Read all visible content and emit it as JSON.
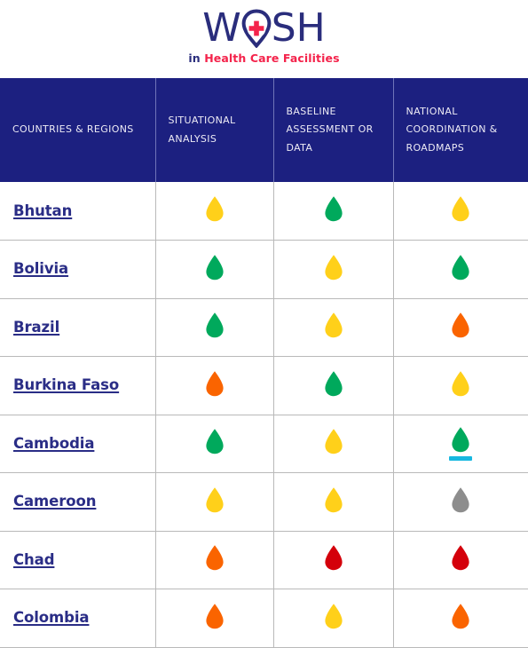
{
  "logo": {
    "wordmark_before": "W",
    "wordmark_after": "SH",
    "droplet_letter": "A",
    "tagline_prefix": "in",
    "tagline_main": "Health Care Facilities",
    "navy": "#2a2d7c",
    "red": "#f4234b"
  },
  "table": {
    "headers": [
      "COUNTRIES & REGIONS",
      "SITUATIONAL ANALYSIS",
      "BASELINE ASSESSMENT OR DATA",
      "NATIONAL COORDINATION & ROADMAPS"
    ],
    "header_bg": "#1c2080",
    "header_text_color": "#eceaf4",
    "status_colors": {
      "green": "#00a95c",
      "yellow": "#ffd01a",
      "orange": "#fa6400",
      "red": "#d4000b",
      "grey": "#8d8d8d"
    },
    "highlight_color": "#16b8e0",
    "rows": [
      {
        "country": "Bhutan",
        "situational_analysis": "yellow",
        "baseline_assessment": "green",
        "national_coordination": "yellow",
        "highlighted": ""
      },
      {
        "country": "Bolivia",
        "situational_analysis": "green",
        "baseline_assessment": "yellow",
        "national_coordination": "green",
        "highlighted": ""
      },
      {
        "country": "Brazil",
        "situational_analysis": "green",
        "baseline_assessment": "yellow",
        "national_coordination": "orange",
        "highlighted": ""
      },
      {
        "country": "Burkina Faso",
        "situational_analysis": "orange",
        "baseline_assessment": "green",
        "national_coordination": "yellow",
        "highlighted": ""
      },
      {
        "country": "Cambodia",
        "situational_analysis": "green",
        "baseline_assessment": "yellow",
        "national_coordination": "green",
        "highlighted": "national_coordination"
      },
      {
        "country": "Cameroon",
        "situational_analysis": "yellow",
        "baseline_assessment": "yellow",
        "national_coordination": "grey",
        "highlighted": ""
      },
      {
        "country": "Chad",
        "situational_analysis": "orange",
        "baseline_assessment": "red",
        "national_coordination": "red",
        "highlighted": ""
      },
      {
        "country": "Colombia",
        "situational_analysis": "orange",
        "baseline_assessment": "yellow",
        "national_coordination": "orange",
        "highlighted": ""
      }
    ]
  }
}
